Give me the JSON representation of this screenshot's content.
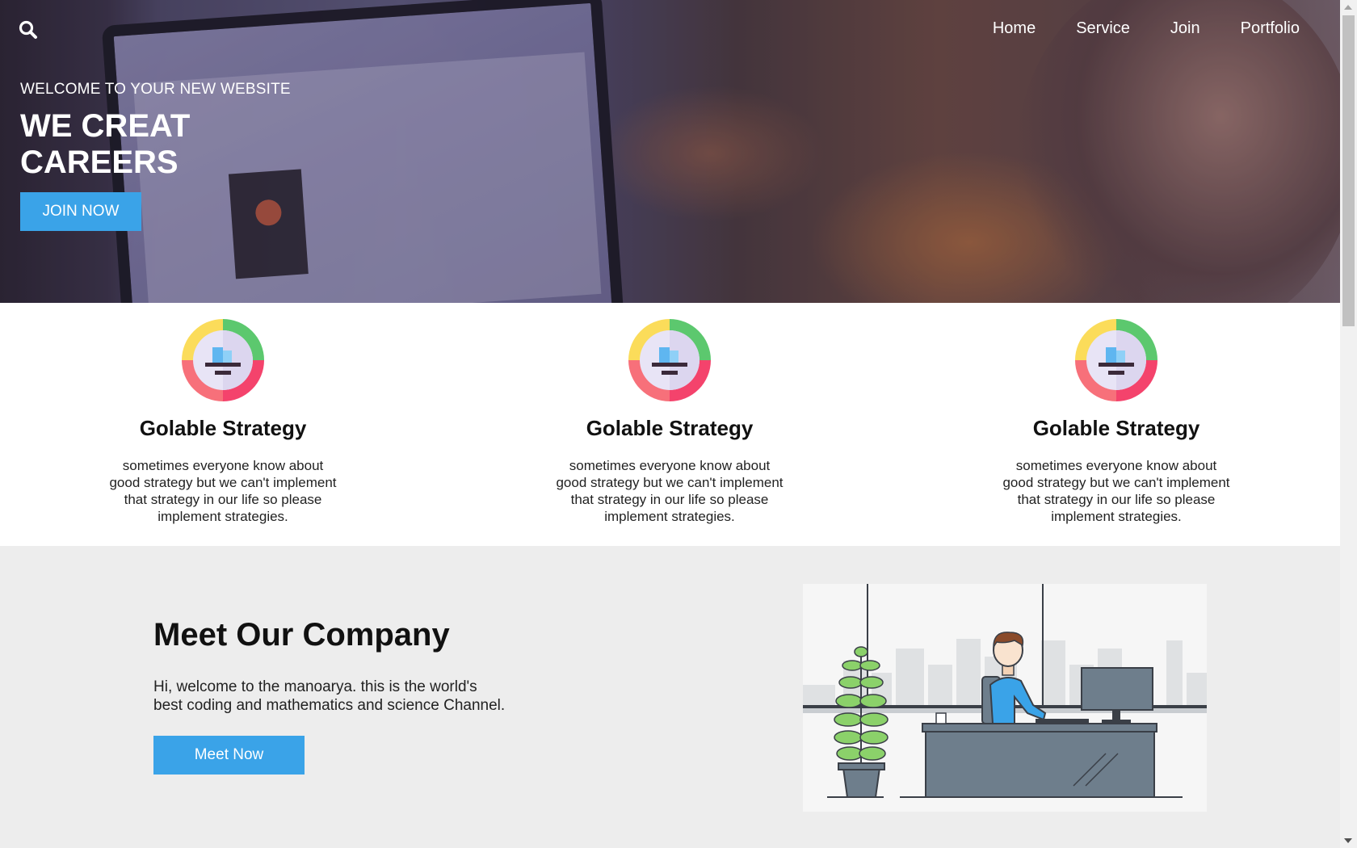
{
  "header": {
    "search_icon": "search-icon",
    "nav": [
      "Home",
      "Service",
      "Join",
      "Portfolio"
    ]
  },
  "hero": {
    "subtitle": "WELCOME TO YOUR NEW WEBSITE",
    "title": "WE CREAT CAREERS",
    "cta": "JOIN NOW"
  },
  "features": [
    {
      "icon": "strategy-icon",
      "title": "Golable Strategy",
      "text": "sometimes everyone know about good strategy but we can't implement that strategy in our life so please implement strategies."
    },
    {
      "icon": "strategy-icon",
      "title": "Golable Strategy",
      "text": "sometimes everyone know about good strategy but we can't implement that strategy in our life so please implement strategies."
    },
    {
      "icon": "strategy-icon",
      "title": "Golable Strategy",
      "text": "sometimes everyone know about good strategy but we can't implement that strategy in our life so please implement strategies."
    }
  ],
  "company": {
    "title": "Meet Our Company",
    "description": "Hi, welcome to the manoarya. this is the world's best coding and mathematics and science Channel.",
    "cta": "Meet Now"
  },
  "colors": {
    "accent": "#3aa3e8",
    "section_bg": "#ededed"
  }
}
